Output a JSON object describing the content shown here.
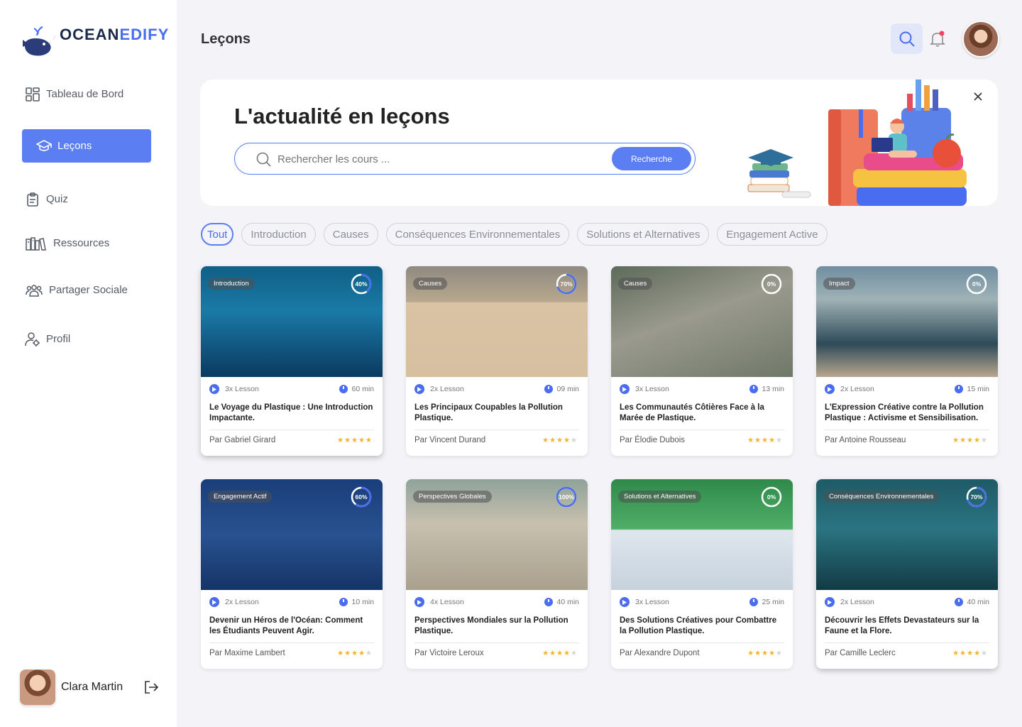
{
  "brand": {
    "word1": "OCEAN",
    "word2": "EDIFY"
  },
  "sidebar": {
    "items": [
      {
        "label": "Tableau de Bord",
        "icon": "dashboard-icon"
      },
      {
        "label": "Leçons",
        "icon": "graduation-cap-icon"
      },
      {
        "label": "Quiz",
        "icon": "clipboard-icon"
      },
      {
        "label": "Ressources",
        "icon": "books-icon"
      },
      {
        "label": "Partager Sociale",
        "icon": "group-icon"
      },
      {
        "label": "Profil",
        "icon": "user-settings-icon"
      }
    ],
    "user": {
      "name": "Clara Martin"
    }
  },
  "header": {
    "title": "Leçons"
  },
  "hero": {
    "title": "L'actualité en leçons",
    "search_placeholder": "Rechercher les cours ...",
    "search_button": "Recherche"
  },
  "filters": [
    "Tout",
    "Introduction",
    "Causes",
    "Conséquences Environnementales",
    "Solutions et Alternatives",
    "Engagement Active"
  ],
  "cards": [
    {
      "tag": "Introduction",
      "progress": "40%",
      "p": 40,
      "lessons": "3x Lesson",
      "duration": "60 min",
      "title": "Le Voyage du Plastique : Une  Introduction Impactante.",
      "author": "Par Gabriel Girard",
      "rating": 5
    },
    {
      "tag": "Causes",
      "progress": "70%",
      "p": 70,
      "lessons": "2x Lesson",
      "duration": "09 min",
      "title": "Les Principaux Coupables la Pollution Plastique.",
      "author": "Par Vincent Durand",
      "rating": 4
    },
    {
      "tag": "Causes",
      "progress": "0%",
      "p": 0,
      "lessons": "3x Lesson",
      "duration": "13 min",
      "title": "Les Communautés Côtières Face à la Marée de Plastique.",
      "author": "Par Élodie Dubois",
      "rating": 4
    },
    {
      "tag": "Impact",
      "progress": "0%",
      "p": 0,
      "lessons": "2x Lesson",
      "duration": "15 min",
      "title": "L'Expression Créative contre la Pollution Plastique : Activisme et Sensibilisation.",
      "author": "Par Antoine Rousseau",
      "rating": 4
    },
    {
      "tag": "Engagement Actif",
      "progress": "60%",
      "p": 60,
      "lessons": "2x Lesson",
      "duration": "10 min",
      "title": "Devenir un Héros de l'Océan: Comment les Étudiants Peuvent Agir.",
      "author": "Par Maxime Lambert",
      "rating": 4
    },
    {
      "tag": "Perspectives Globales",
      "progress": "100%",
      "p": 100,
      "lessons": "4x Lesson",
      "duration": "40 min",
      "title": "Perspectives Mondiales sur la Pollution Plastique.",
      "author": "Par Victoire Leroux",
      "rating": 4
    },
    {
      "tag": "Solutions et Alternatives",
      "progress": "0%",
      "p": 0,
      "lessons": "3x Lesson",
      "duration": "25 min",
      "title": "Des Solutions Créatives pour Combattre la Pollution Plastique.",
      "author": "Par Alexandre Dupont",
      "rating": 4
    },
    {
      "tag": "Conséquences Environnementales",
      "progress": "70%",
      "p": 70,
      "lessons": "2x Lesson",
      "duration": "40 min",
      "title": "Découvrir les Effets Devastateurs sur la Faune et la Flore.",
      "author": "Par Camille Leclerc",
      "rating": 4
    }
  ],
  "colors": {
    "accent": "#5b7ef2",
    "star": "#f1b52b"
  }
}
